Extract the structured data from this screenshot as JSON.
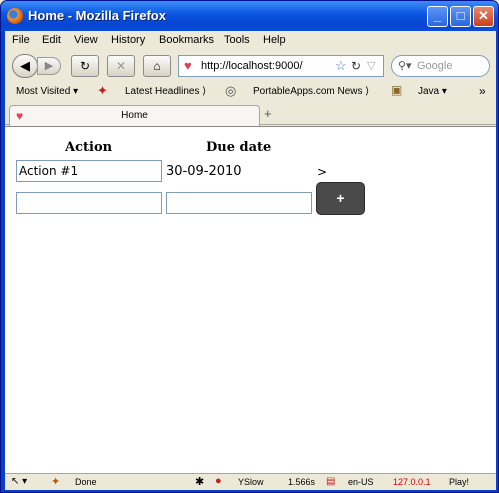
{
  "window": {
    "title": "Home - Mozilla Firefox"
  },
  "menu": [
    "File",
    "Edit",
    "View",
    "History",
    "Bookmarks",
    "Tools",
    "Help"
  ],
  "nav": {
    "url": "http://localhost:9000/",
    "search_placeholder": "Google"
  },
  "bookmarks": [
    "Most Visited",
    "Latest Headlines",
    "PortableApps.com News",
    "Java"
  ],
  "tab": {
    "label": "Home"
  },
  "page": {
    "headers": {
      "action": "Action",
      "due": "Due date"
    },
    "row": {
      "action": "Action #1",
      "due": "30-09-2010",
      "arrow": ">"
    },
    "new_row": {
      "action": "",
      "due": ""
    },
    "add_button": "+"
  },
  "status": {
    "text": "Done",
    "yslow": "YSlow",
    "time": "1.566s",
    "lang": "en-US",
    "ip": "127.0.0.1",
    "play": "Play!"
  }
}
